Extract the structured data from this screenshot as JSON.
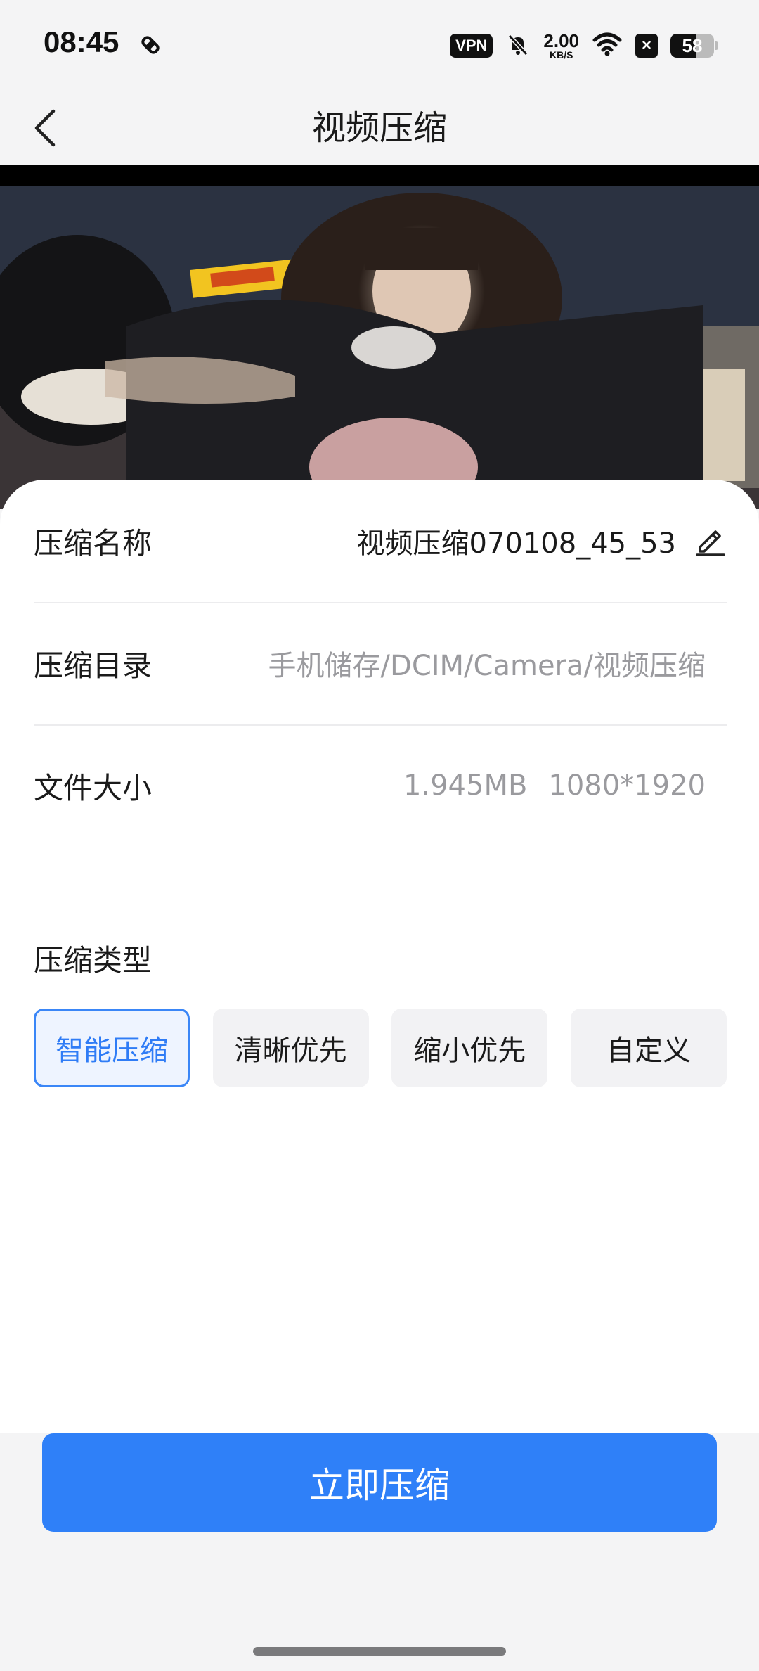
{
  "status_bar": {
    "time": "08:45",
    "vpn": "VPN",
    "speed_value": "2.00",
    "speed_unit": "KB/S",
    "battery": "58",
    "x_badge": "×"
  },
  "header": {
    "title": "视频压缩"
  },
  "info": {
    "name_label": "压缩名称",
    "name_value": "视频压缩070108_45_53",
    "dir_label": "压缩目录",
    "dir_value": "手机储存/DCIM/Camera/视频压缩",
    "size_label": "文件大小",
    "size_value": "1.945MB",
    "resolution_value": "1080*1920"
  },
  "compress_type": {
    "title": "压缩类型",
    "options": [
      "智能压缩",
      "清晰优先",
      "缩小优先",
      "自定义"
    ],
    "selected": "智能压缩"
  },
  "action": {
    "compress_label": "立即压缩"
  },
  "colors": {
    "accent": "#2f80f8",
    "selected_border": "#3a86f7",
    "selected_bg": "#eef4ff"
  }
}
